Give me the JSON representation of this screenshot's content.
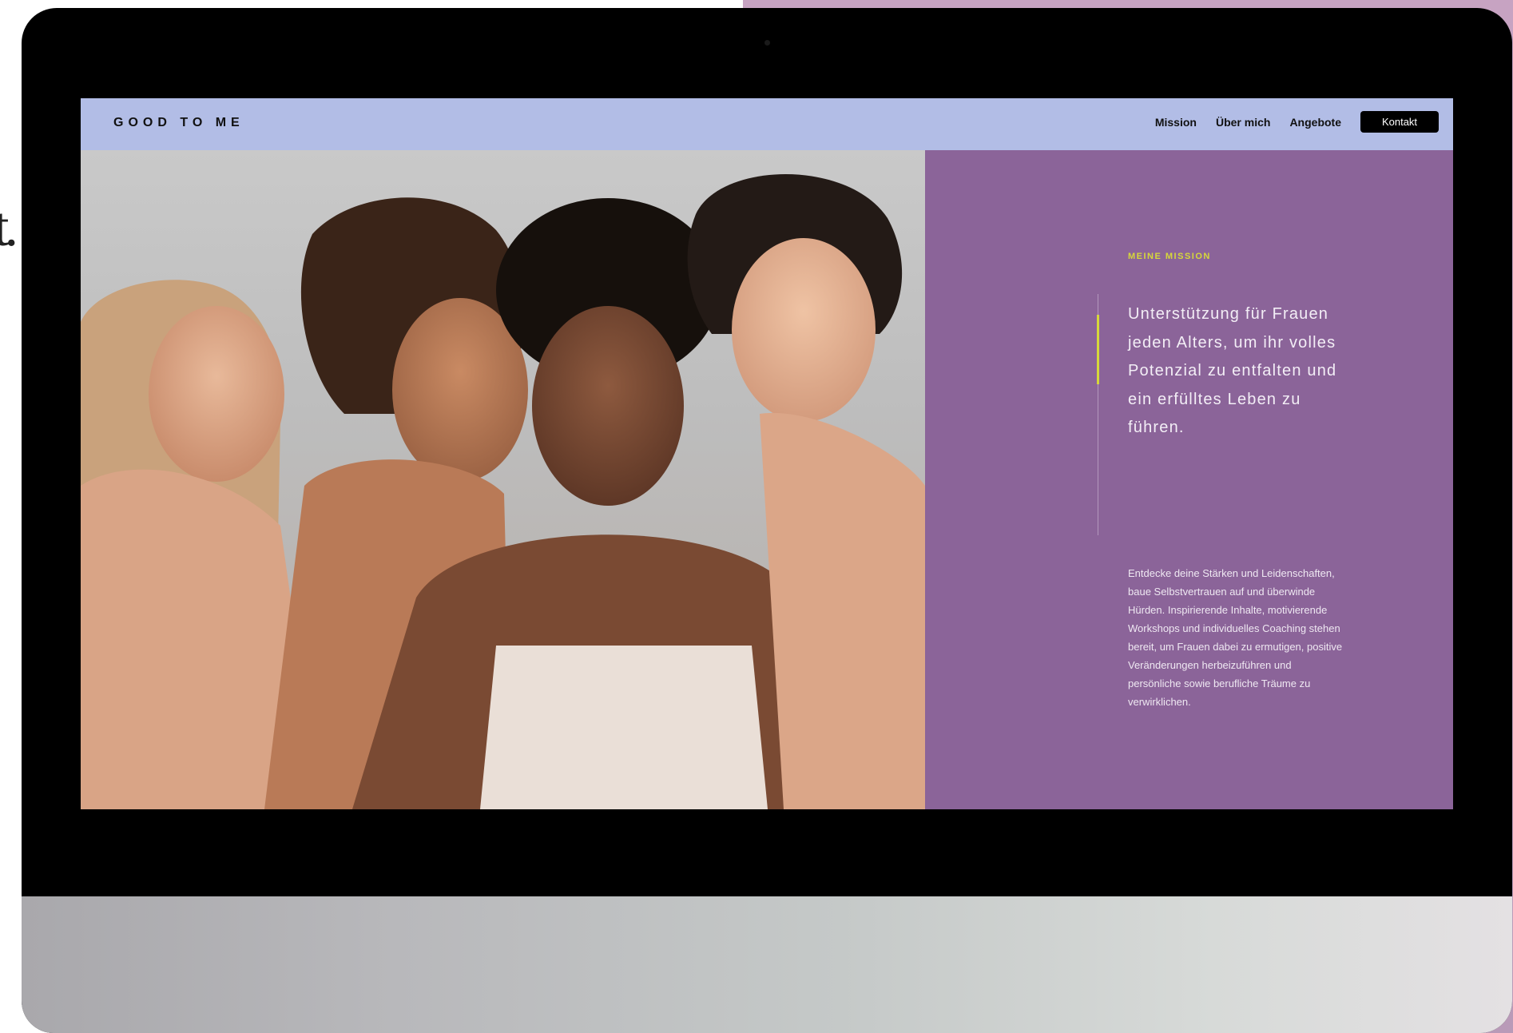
{
  "site": {
    "brand": "GOOD TO ME",
    "nav": [
      {
        "label": "Mission"
      },
      {
        "label": "Über mich"
      },
      {
        "label": "Angebote"
      }
    ],
    "cta_label": "Kontakt"
  },
  "hero": {
    "image_alt": "Vier lächelnde Frauen"
  },
  "mission": {
    "kicker": "MEINE MISSION",
    "headline": "Unterstützung für Frauen jeden Alters, um ihr volles Potenzial zu entfalten und ein erfülltes Leben zu führen.",
    "body": "Entdecke deine Stärken und Leidenschaften, baue Selbstvertrauen auf und überwinde Hürden. Inspirierende Inhalte, motivierende Workshops und individuelles Coaching stehen bereit, um Frauen dabei zu ermutigen, positive Veränderungen herbeizuführen und persönliche sowie berufliche Träume zu verwirklichen."
  },
  "colors": {
    "navbar": "#b2bde6",
    "mission_panel": "#8b6499",
    "accent": "#d6d83a",
    "cta_bg": "#000000"
  },
  "edge_text": "t."
}
